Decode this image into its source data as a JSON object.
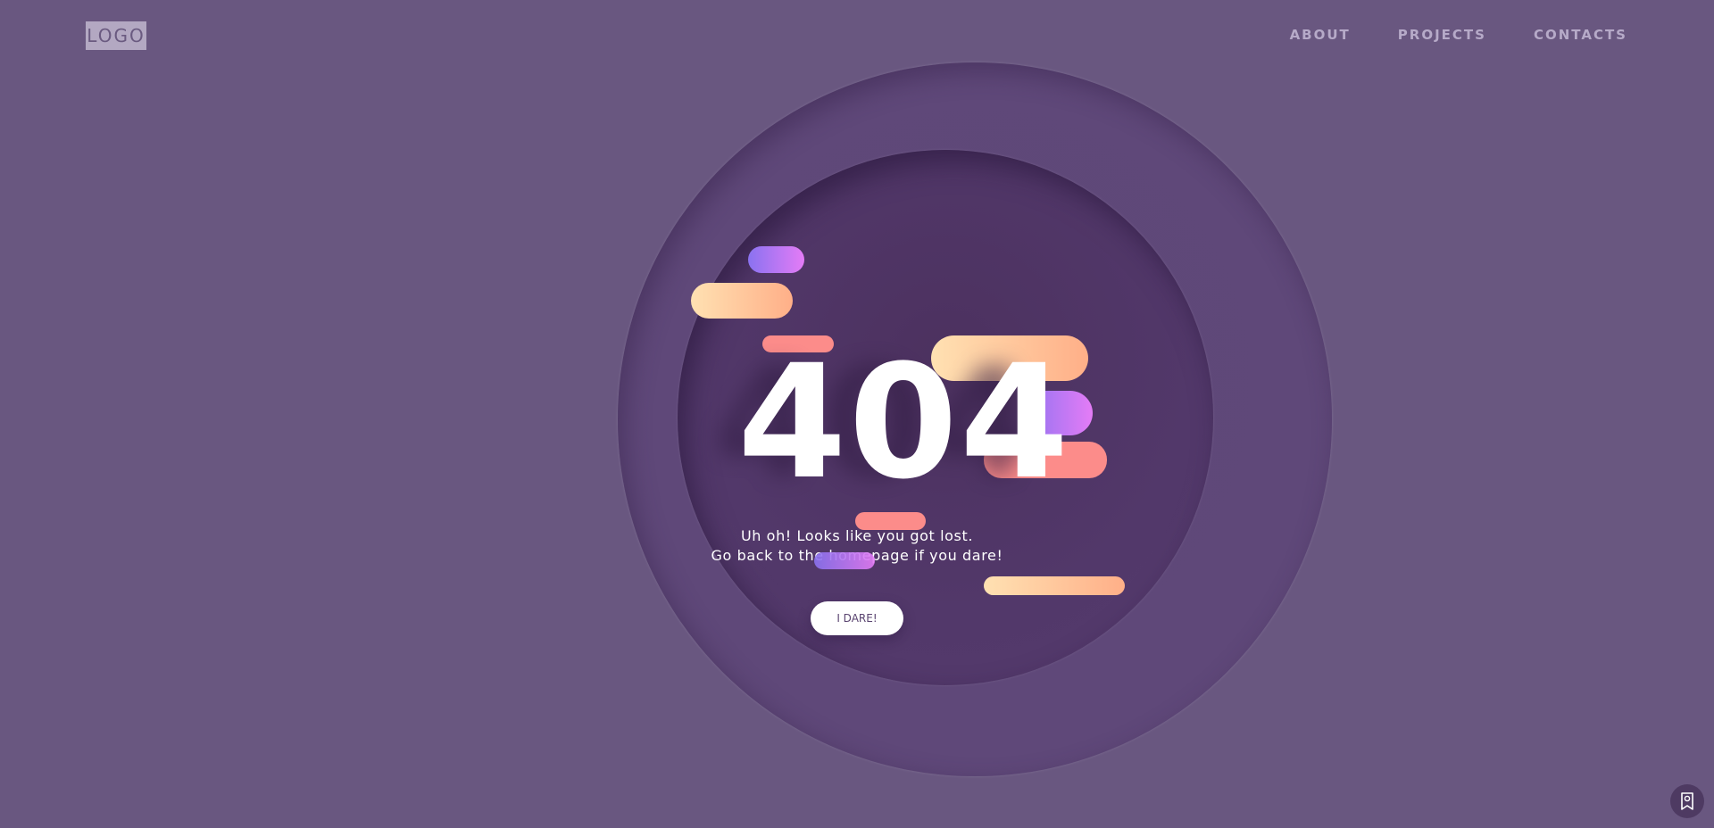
{
  "header": {
    "logo": "LOGO",
    "nav": [
      "ABOUT",
      "PROJECTS",
      "CONTACTS"
    ]
  },
  "main": {
    "code": "404",
    "message_line1": "Uh oh! Looks like you got lost.",
    "message_line2": "Go back to the homepage if you dare!",
    "button_label": "I DARE!"
  },
  "colors": {
    "background": "#695780",
    "outer_circle": "#5f4879",
    "inner_circle": "#52386a",
    "coral": "#fc8c8a",
    "peach_start": "#ffe1b2",
    "peach_end": "#ffaf88",
    "purple_start": "#8a72f0",
    "purple_end": "#e47cf6"
  },
  "icons": {
    "widget": "bookmark-person-icon"
  }
}
